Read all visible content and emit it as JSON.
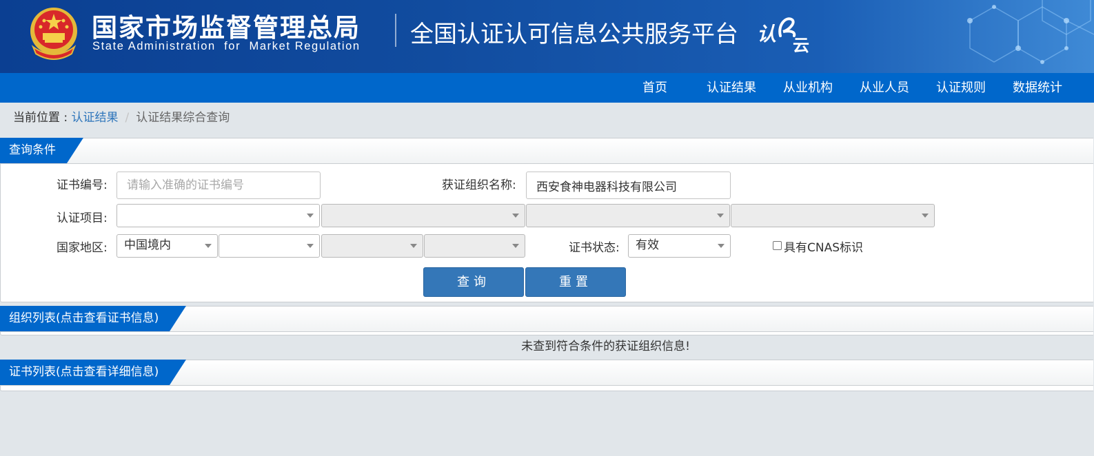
{
  "header": {
    "org_name_cn": "国家市场监督管理总局",
    "org_name_en": "State Administration  for  Market Regulation",
    "platform_title": "全国认证认可信息公共服务平台",
    "logo_text_1": "认",
    "logo_text_2": "云"
  },
  "nav": {
    "items": [
      "首页",
      "认证结果",
      "从业机构",
      "从业人员",
      "认证规则",
      "数据统计"
    ]
  },
  "breadcrumb": {
    "prefix": "当前位置 : ",
    "link": "认证结果",
    "separator": "/",
    "current": "认证结果综合查询"
  },
  "query_panel": {
    "title": "查询条件",
    "cert_no_label": "证书编号:",
    "cert_no_placeholder": "请输入准确的证书编号",
    "org_name_label": "获证组织名称:",
    "org_name_value": "西安食神电器科技有限公司",
    "project_label": "认证项目:",
    "region_label": "国家地区:",
    "region_value": "中国境内",
    "status_label": "证书状态:",
    "status_value": "有效",
    "cnas_label": "具有CNAS标识",
    "search_button": "查询",
    "reset_button": "重置"
  },
  "org_list": {
    "title": "组织列表(点击查看证书信息)",
    "empty_message": "未查到符合条件的获证组织信息!"
  },
  "cert_list": {
    "title": "证书列表(点击查看详细信息)"
  },
  "colors": {
    "banner": "#114c9f",
    "nav": "#0067cb",
    "button": "#3477b8",
    "link": "#2f76bb"
  }
}
